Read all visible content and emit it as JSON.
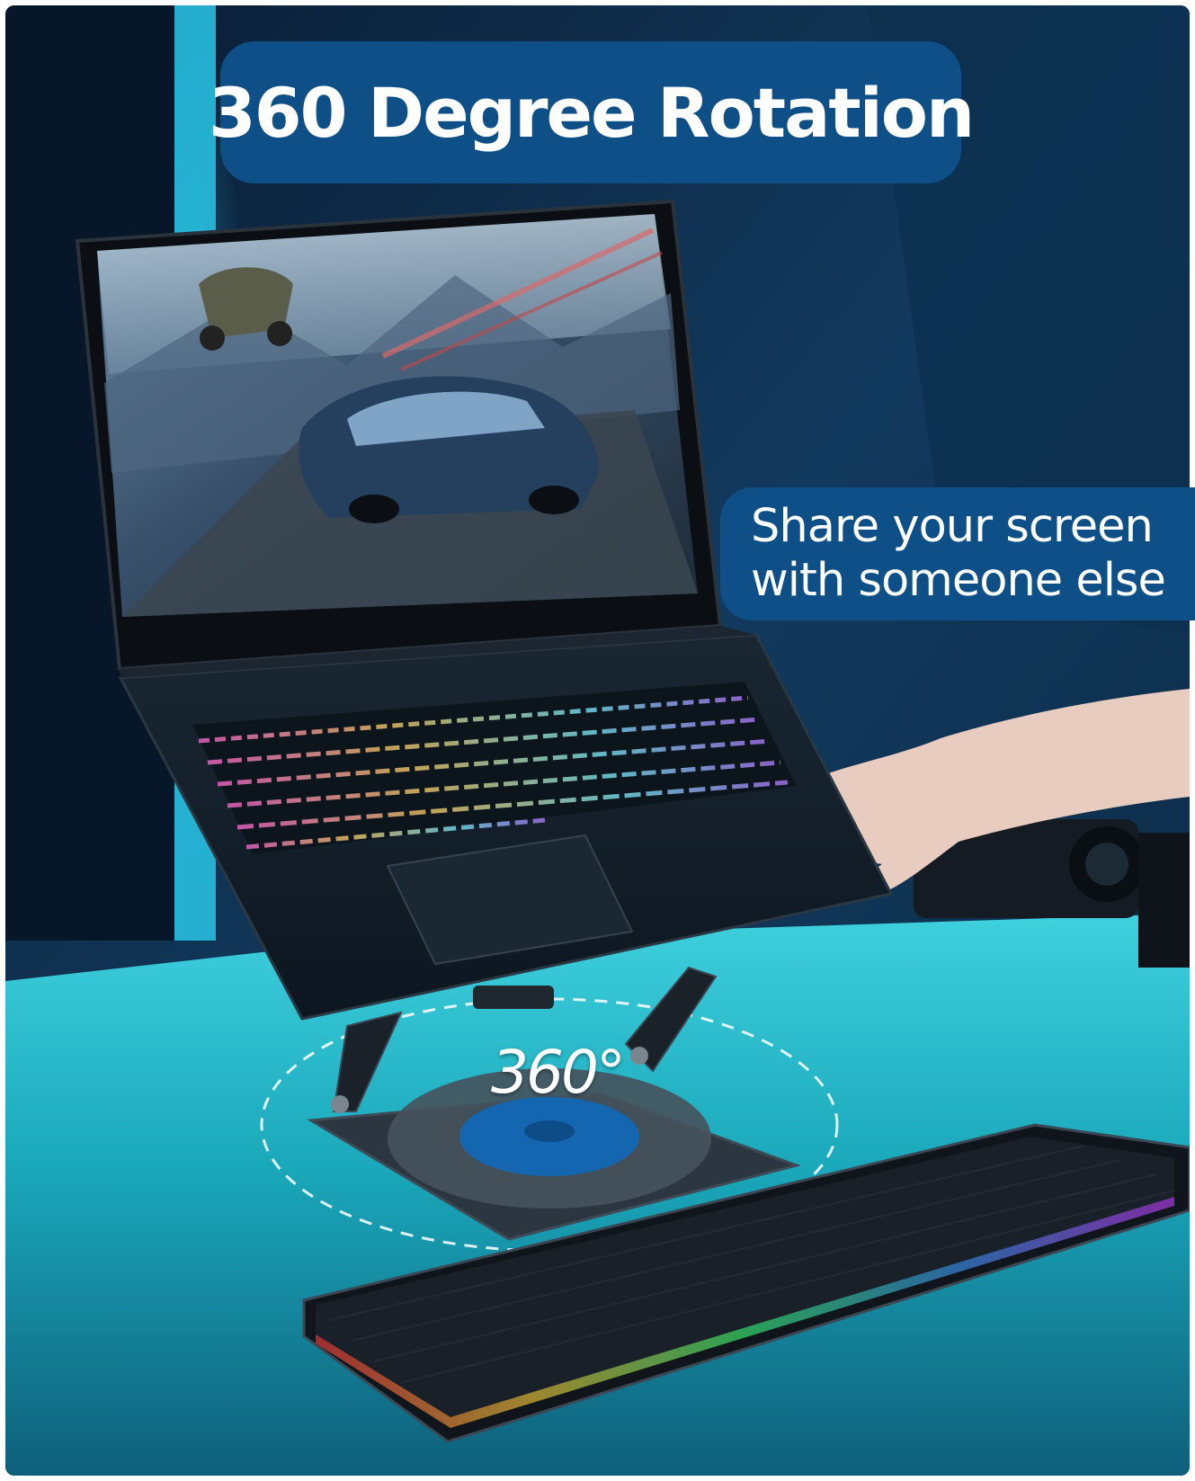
{
  "headline": "360 Degree Rotation",
  "callout": {
    "line1": "Share your screen",
    "line2": "with someone else"
  },
  "rotation_label": "360°",
  "colors": {
    "banner": "#0d4f86",
    "desk": "#1fb3c4",
    "background": "#0b2540",
    "accent_glow": "#29c6e8",
    "turntable": "#1466b0"
  }
}
